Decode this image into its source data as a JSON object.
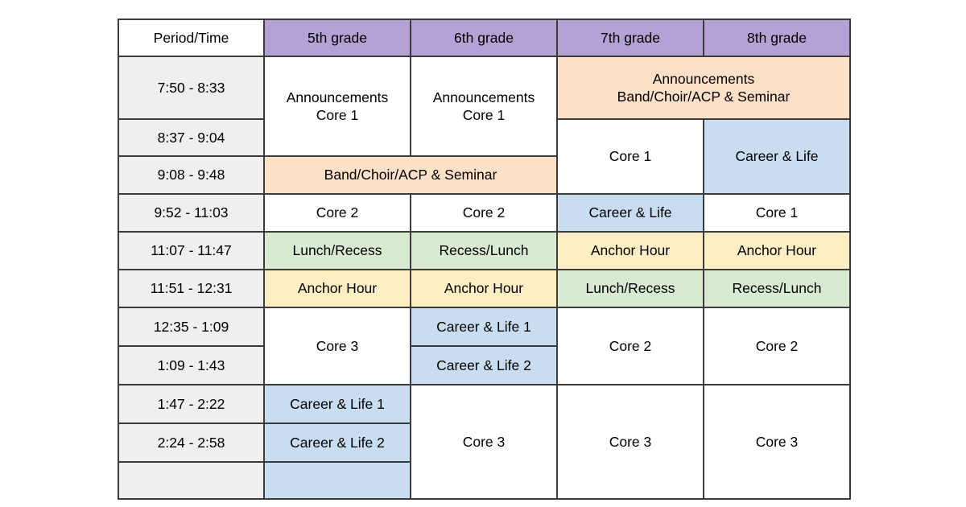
{
  "table": {
    "columns": [
      {
        "key": "time",
        "label": "Period/Time",
        "fill": "white"
      },
      {
        "key": "g5",
        "label": "5th grade",
        "fill": "purple"
      },
      {
        "key": "g6",
        "label": "6th grade",
        "fill": "purple"
      },
      {
        "key": "g7",
        "label": "7th grade",
        "fill": "purple"
      },
      {
        "key": "g8",
        "label": "8th grade",
        "fill": "purple"
      }
    ],
    "times": [
      "7:50 - 8:33",
      "8:37 - 9:04",
      "9:08 - 9:48",
      "9:52 - 11:03",
      "11:07 - 11:47",
      "11:51 - 12:31",
      "12:35 - 1:09",
      "1:09 - 1:43",
      "1:47 - 2:22",
      "2:24 - 2:58",
      ""
    ],
    "cells": {
      "r1_g5_g6_announcements": "Announcements\nCore 1",
      "r1_g78_announcements": "Announcements\nBand/Choir/ACP & Seminar",
      "r2_g7_core1": "Core 1",
      "r2_g8_career": "Career & Life",
      "r3_g5g6_band": "Band/Choir/ACP & Seminar",
      "r4_g5_core2": "Core 2",
      "r4_g6_core2": "Core 2",
      "r4_g7_career": "Career & Life",
      "r4_g8_core1": "Core 1",
      "r5_g5_lunch": "Lunch/Recess",
      "r5_g6_lunch": "Recess/Lunch",
      "r5_g7_anchor": "Anchor Hour",
      "r5_g8_anchor": "Anchor Hour",
      "r6_g5_anchor": "Anchor Hour",
      "r6_g6_anchor": "Anchor Hour",
      "r6_g7_lunch": "Lunch/Recess",
      "r6_g8_lunch": "Recess/Lunch",
      "r7_g5_core3": "Core 3",
      "r7_g6_career1": "Career & Life 1",
      "r8_g6_career2": "Career & Life 2",
      "r7_g7_core2": "Core 2",
      "r7_g8_core2": "Core 2",
      "r9_g5_career1": "Career & Life 1",
      "r10_g5_career2": "Career & Life 2",
      "r9_g6_core3": "Core 3",
      "r9_g7_core3": "Core 3",
      "r9_g8_core3": "Core 3",
      "r11_g5_blank": "",
      "r11_time_blank": ""
    }
  },
  "colors": {
    "purple": "#b5a2d4",
    "orange": "#fce0c8",
    "green": "#d9ead3",
    "yellow": "#fdeec4",
    "blue": "#c9ddf0",
    "gray": "#efefef",
    "border": "#3b3b3b",
    "page_background": "#ffffff"
  }
}
